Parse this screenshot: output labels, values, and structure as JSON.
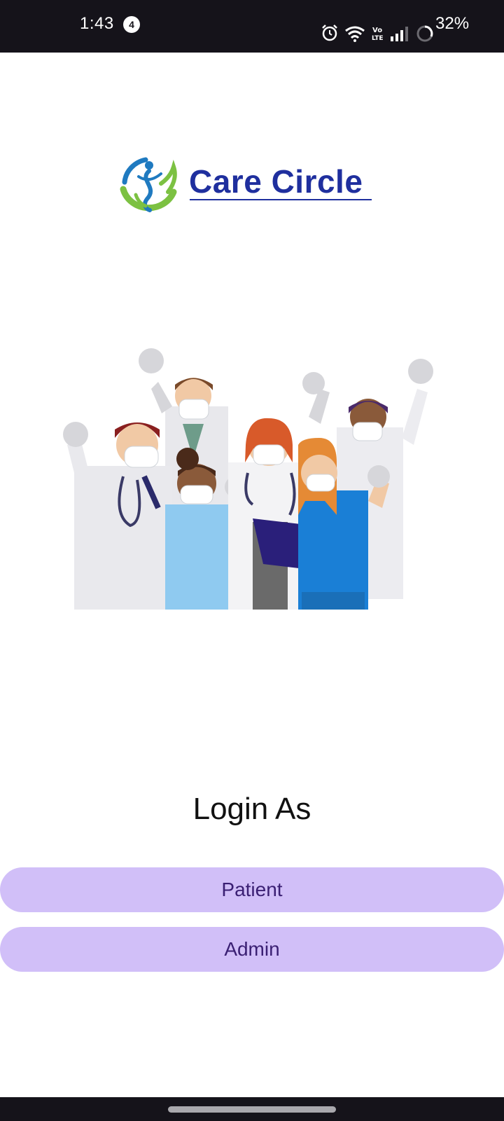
{
  "status_bar": {
    "time": "1:43",
    "notification_count": "4",
    "icons": [
      "alarm-icon",
      "wifi-icon",
      "volte-icon",
      "signal-icon",
      "battery-icon"
    ],
    "battery_percent": "32%"
  },
  "logo": {
    "text": "Care Circle",
    "colors": {
      "text": "#1f2f9e",
      "green": "#7cc142",
      "blue": "#1f7ac0"
    }
  },
  "illustration": {
    "icon": "doctors-group-illustration"
  },
  "login": {
    "title": "Login As",
    "buttons": [
      {
        "label": "Patient"
      },
      {
        "label": "Admin"
      }
    ],
    "colors": {
      "button_bg": "#d1bff8",
      "button_text": "#3a1f73"
    }
  }
}
